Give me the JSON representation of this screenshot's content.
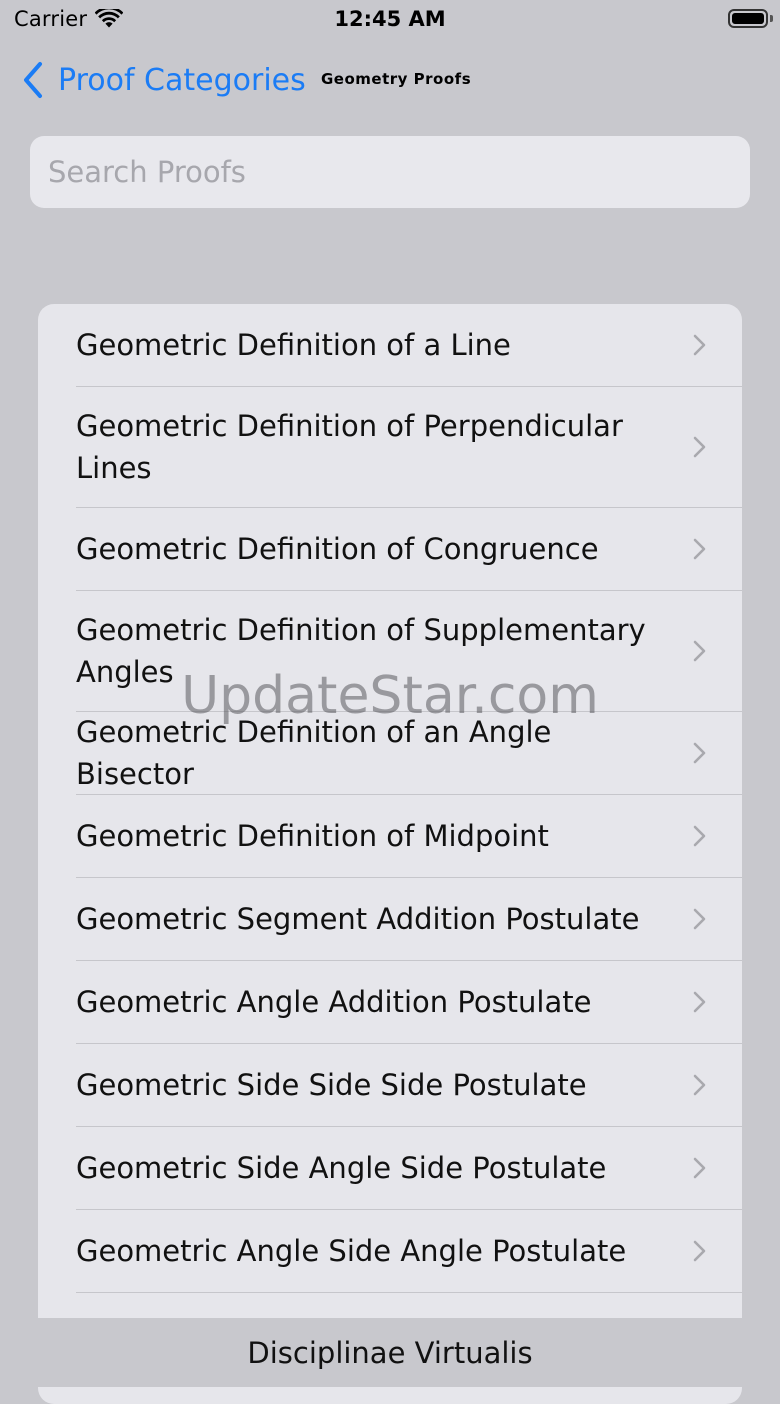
{
  "status_bar": {
    "carrier": "Carrier",
    "time": "12:45 AM"
  },
  "nav": {
    "back_label": "Proof Categories",
    "title": "Geometry Proofs"
  },
  "search": {
    "placeholder": "Search Proofs",
    "value": ""
  },
  "list": {
    "items": [
      {
        "label": "Geometric Definition of a Line"
      },
      {
        "label": "Geometric Definition of Perpendicular Lines"
      },
      {
        "label": "Geometric Definition of Congruence"
      },
      {
        "label": "Geometric Definition of Supplementary Angles"
      },
      {
        "label": "Geometric Definition of an Angle Bisector"
      },
      {
        "label": "Geometric Definition of Midpoint"
      },
      {
        "label": "Geometric Segment Addition Postulate"
      },
      {
        "label": "Geometric Angle Addition Postulate"
      },
      {
        "label": "Geometric Side Side Side Postulate"
      },
      {
        "label": "Geometric Side Angle Side Postulate"
      },
      {
        "label": "Geometric Angle Side Angle Postulate"
      }
    ]
  },
  "footer": {
    "label": "Disciplinae Virtualis"
  },
  "watermark": {
    "text": "UpdateStar.com"
  },
  "icons": {
    "back": "chevron-left-icon",
    "row": "chevron-right-icon",
    "wifi": "wifi-icon",
    "battery": "battery-icon"
  },
  "colors": {
    "accent": "#1b7cf5",
    "background": "#c8c8cd",
    "card": "#e6e6eb"
  }
}
